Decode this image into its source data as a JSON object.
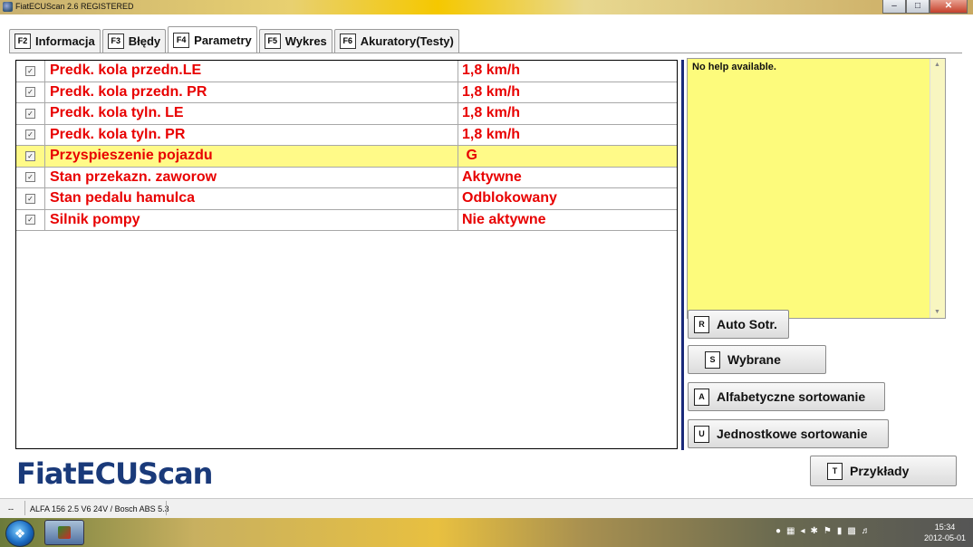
{
  "window": {
    "title": "FiatECUScan 2.6 REGISTERED"
  },
  "tabs": [
    {
      "key": "F2",
      "label": "Informacja"
    },
    {
      "key": "F3",
      "label": "Błędy"
    },
    {
      "key": "F4",
      "label": "Parametry",
      "active": true
    },
    {
      "key": "F5",
      "label": "Wykres"
    },
    {
      "key": "F6",
      "label": "Akuratory(Testy)"
    }
  ],
  "parameters": [
    {
      "name": "Predk. kola przedn.LE",
      "value": "1,8 km/h",
      "checked": true
    },
    {
      "name": "Predk. kola przedn. PR",
      "value": "1,8 km/h",
      "checked": true
    },
    {
      "name": "Predk. kola tyln. LE",
      "value": "1,8 km/h",
      "checked": true
    },
    {
      "name": "Predk. kola tyln. PR",
      "value": "1,8 km/h",
      "checked": true
    },
    {
      "name": "Przyspieszenie pojazdu",
      "value": " G",
      "checked": true,
      "highlight": true
    },
    {
      "name": "Stan przekazn. zaworow",
      "value": "Aktywne",
      "checked": true
    },
    {
      "name": "Stan pedalu hamulca",
      "value": "Odblokowany",
      "checked": true
    },
    {
      "name": "Silnik pompy",
      "value": "Nie aktywne",
      "checked": true
    }
  ],
  "help": {
    "text": "No help available."
  },
  "buttons": {
    "auto_sort": {
      "key": "R",
      "label": "Auto Sotr."
    },
    "selected": {
      "key": "S",
      "label": "Wybrane"
    },
    "alpha_sort": {
      "key": "A",
      "label": "Alfabetyczne sortowanie"
    },
    "unit_sort": {
      "key": "U",
      "label": "Jednostkowe sortowanie"
    },
    "examples": {
      "key": "T",
      "label": "Przykłady"
    }
  },
  "logo": "FiatECUScan",
  "status": {
    "seg1": "--",
    "vehicle": "ALFA 156 2.5 V6 24V / Bosch ABS 5.3"
  },
  "taskbar": {
    "time": "15:34",
    "date": "2012-05-01"
  }
}
